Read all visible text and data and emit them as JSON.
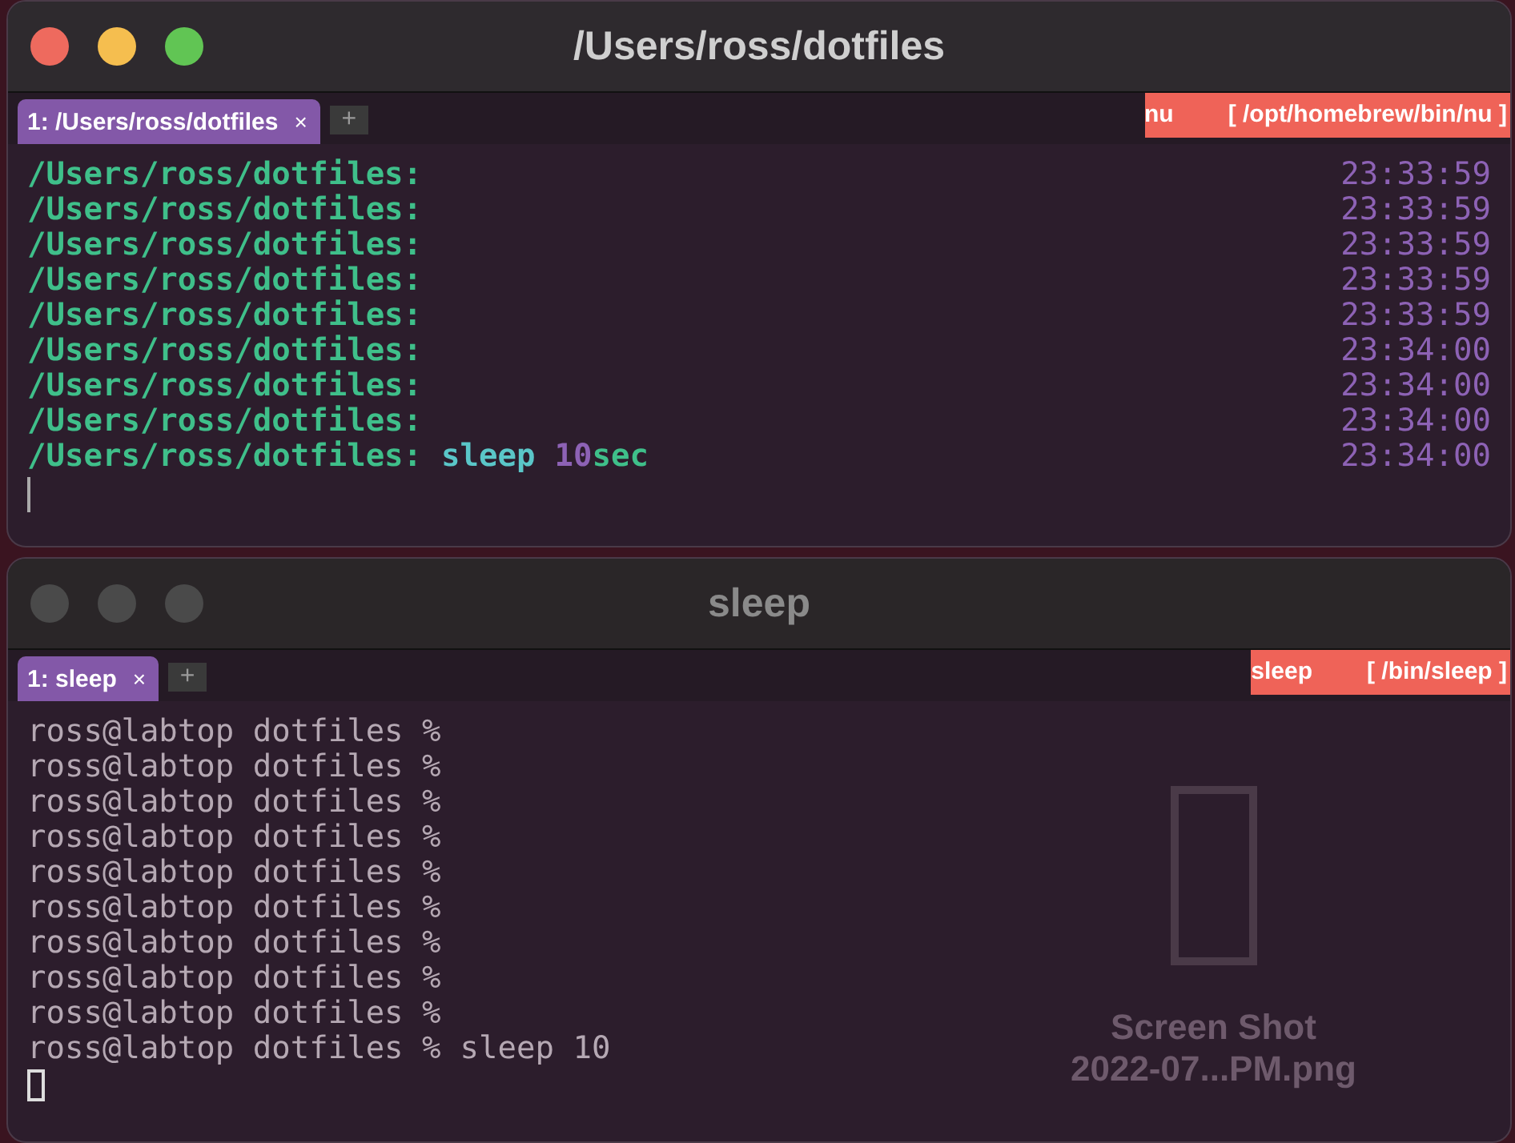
{
  "windows": [
    {
      "title": "/Users/ross/dotfiles",
      "active": true,
      "tabs": [
        {
          "label": "1: /Users/ross/dotfiles",
          "close": "×",
          "selected": true
        }
      ],
      "new_tab": "+",
      "status": {
        "process": "nu",
        "path": "[ /opt/homebrew/bin/nu ]"
      },
      "kind": "nu",
      "lines": [
        {
          "prompt": "/Users/ross/dotfiles:",
          "time": "23:33:59"
        },
        {
          "prompt": "/Users/ross/dotfiles:",
          "time": "23:33:59"
        },
        {
          "prompt": "/Users/ross/dotfiles:",
          "time": "23:33:59"
        },
        {
          "prompt": "/Users/ross/dotfiles:",
          "time": "23:33:59"
        },
        {
          "prompt": "/Users/ross/dotfiles:",
          "time": "23:33:59"
        },
        {
          "prompt": "/Users/ross/dotfiles:",
          "time": "23:34:00"
        },
        {
          "prompt": "/Users/ross/dotfiles:",
          "time": "23:34:00"
        },
        {
          "prompt": "/Users/ross/dotfiles:",
          "time": "23:34:00"
        },
        {
          "prompt": "/Users/ross/dotfiles:",
          "command": "sleep",
          "number": "10",
          "unit": "sec",
          "time": "23:34:00"
        }
      ]
    },
    {
      "title": "sleep",
      "active": false,
      "tabs": [
        {
          "label": "1: sleep",
          "close": "×",
          "selected": true
        }
      ],
      "new_tab": "+",
      "status": {
        "process": "sleep",
        "path": "[ /bin/sleep ]"
      },
      "kind": "zsh",
      "lines": [
        {
          "prompt": "ross@labtop dotfiles %"
        },
        {
          "prompt": "ross@labtop dotfiles %"
        },
        {
          "prompt": "ross@labtop dotfiles %"
        },
        {
          "prompt": "ross@labtop dotfiles %"
        },
        {
          "prompt": "ross@labtop dotfiles %"
        },
        {
          "prompt": "ross@labtop dotfiles %"
        },
        {
          "prompt": "ross@labtop dotfiles %"
        },
        {
          "prompt": "ross@labtop dotfiles %"
        },
        {
          "prompt": "ross@labtop dotfiles %"
        },
        {
          "prompt": "ross@labtop dotfiles %",
          "command": "sleep 10"
        }
      ],
      "desktop_icons": [
        {
          "name": "Screen Shot",
          "detail": "2022-07...PM.png"
        }
      ]
    }
  ]
}
